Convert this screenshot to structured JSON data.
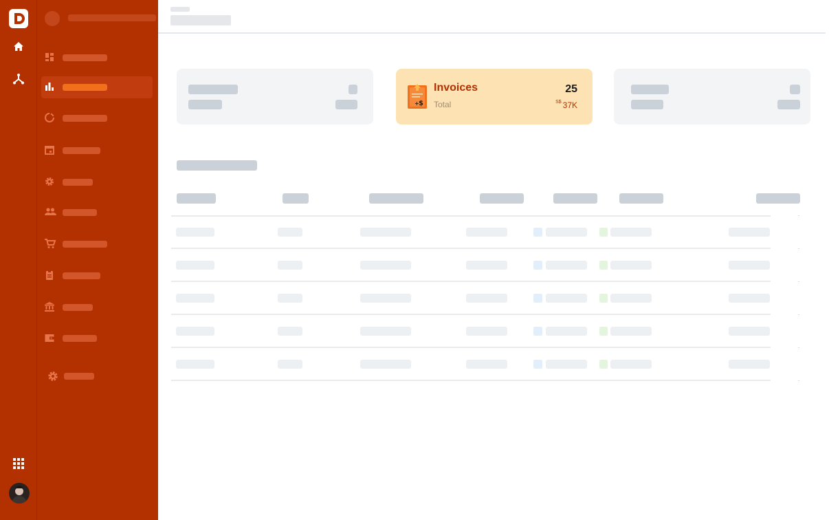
{
  "rail": {
    "icons": [
      "logo-d-icon",
      "home-icon",
      "network-icon",
      "apps-grid-icon",
      "avatar"
    ]
  },
  "sidebar": {
    "items": [
      {
        "icon": "dashboard-icon"
      },
      {
        "icon": "bar-chart-icon",
        "active": true
      },
      {
        "icon": "pie-chart-icon"
      },
      {
        "icon": "calendar-icon"
      },
      {
        "icon": "gear-icon"
      },
      {
        "icon": "people-icon"
      },
      {
        "icon": "cart-icon"
      },
      {
        "icon": "clipboard-icon"
      },
      {
        "icon": "bank-icon"
      },
      {
        "icon": "wallet-icon"
      },
      {
        "icon": "settings-icon"
      }
    ]
  },
  "cards": {
    "invoices": {
      "title": "Invoices",
      "subtitle": "Total",
      "count": "25",
      "currency": "S$",
      "amount": "37K"
    }
  },
  "colors": {
    "brand": "#b33000",
    "accent": "#f26f1c",
    "invoice_card": "#fde3b4"
  }
}
